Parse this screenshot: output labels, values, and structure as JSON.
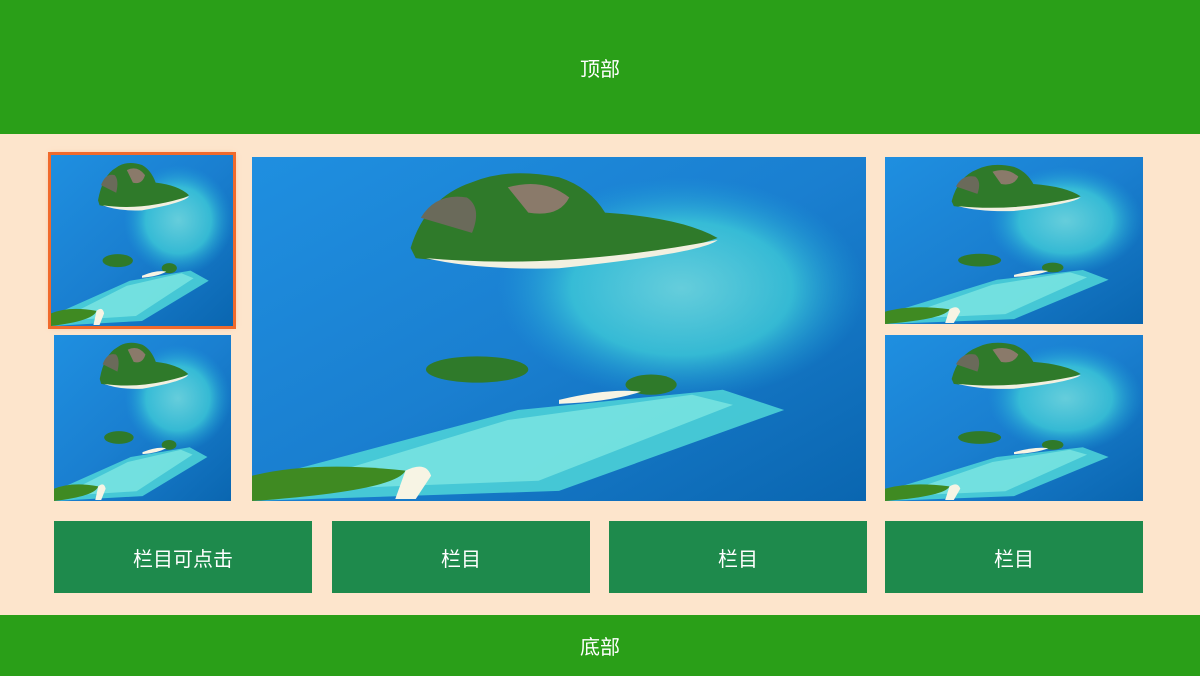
{
  "header": {
    "title": "顶部"
  },
  "footer": {
    "title": "底部"
  },
  "colors": {
    "header_bg": "#2a9f18",
    "page_bg": "#fde5cc",
    "category_bg": "#1e8a4c",
    "focus_border": "#f06a2c"
  },
  "tiles": [
    {
      "image": "tropical-island-photo",
      "focused": true
    },
    {
      "image": "tropical-island-photo",
      "focused": false
    },
    {
      "image": "tropical-island-photo",
      "focused": false
    },
    {
      "image": "tropical-island-photo",
      "focused": false
    },
    {
      "image": "tropical-island-photo",
      "focused": false
    }
  ],
  "categories": [
    {
      "label": "栏目可点击"
    },
    {
      "label": "栏目"
    },
    {
      "label": "栏目"
    },
    {
      "label": "栏目"
    }
  ]
}
